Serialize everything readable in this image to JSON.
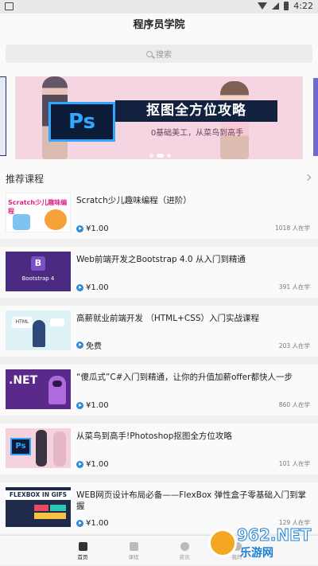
{
  "status_bar": {
    "time": "4:22"
  },
  "header": {
    "title": "程序员学院"
  },
  "search": {
    "placeholder": "搜索"
  },
  "banner": {
    "ps_label": "Ps",
    "title": "抠图全方位攻略",
    "subtitle": "0基础美工，从菜鸟到高手",
    "dots": 3,
    "active_dot": 1
  },
  "section": {
    "title": "推荐课程"
  },
  "courses": [
    {
      "title": "Scratch少儿趣味编程（进阶）",
      "price": "¥1.00",
      "learners": "1018 人在学",
      "thumb_text": "Scratch少儿趣味编程",
      "thumb_bg": "#ffffff"
    },
    {
      "title": "Web前端开发之Bootstrap 4.0 从入门到精通",
      "price": "¥1.00",
      "learners": "391 人在学",
      "thumb_text": "Bootstrap 4",
      "thumb_bg": "#4b2a82"
    },
    {
      "title": "高薪就业前端开发 （HTML+CSS）入门实战课程",
      "price": "免费",
      "learners": "203 人在学",
      "thumb_text": "HTML",
      "thumb_bg": "#dff2f5"
    },
    {
      "title": "“傻瓜式”C#入门到精通，让你的升值加薪offer都快人一步",
      "price": "¥1.00",
      "learners": "860 人在学",
      "thumb_text": ".NET",
      "thumb_bg": "#5a2a8a"
    },
    {
      "title": "从菜鸟到高手!Photoshop抠图全方位攻略",
      "price": "¥1.00",
      "learners": "101 人在学",
      "thumb_text": "Ps",
      "thumb_bg": "#f3d2de"
    },
    {
      "title": "WEB网页设计布局必备——FlexBox 弹性盒子零基础入门到掌握",
      "price": "¥1.00",
      "learners": "129 人在学",
      "thumb_text": "FLEXBOX IN GIFS",
      "thumb_bg": "#1f2a4a"
    }
  ],
  "tabs": [
    {
      "label": "首页",
      "icon": "home-icon"
    },
    {
      "label": "课程",
      "icon": "book-icon"
    },
    {
      "label": "资讯",
      "icon": "compass-icon"
    },
    {
      "label": "我的",
      "icon": "user-icon"
    }
  ],
  "watermark": {
    "text": "962.NET",
    "sub": "乐游网"
  },
  "colors": {
    "accent": "#2f8bd6",
    "banner_bg": "#f6d5e2",
    "ps_blue": "#31a8ff"
  }
}
